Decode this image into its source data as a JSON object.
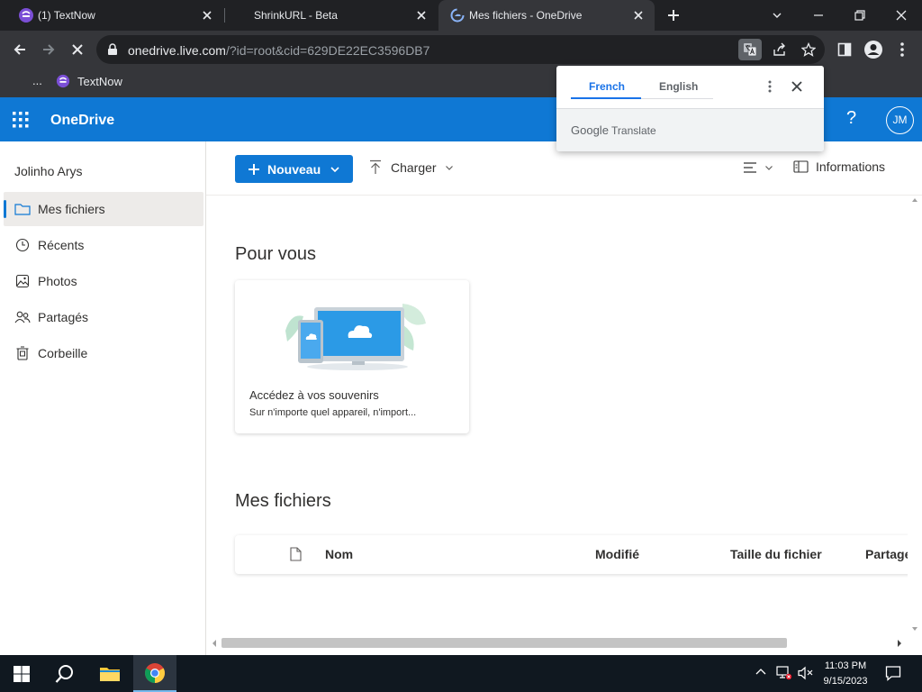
{
  "browser": {
    "tabs": [
      {
        "title": "(1) TextNow",
        "active": false
      },
      {
        "title": "ShrinkURL - Beta",
        "active": false
      },
      {
        "title": "Mes fichiers - OneDrive",
        "active": true
      }
    ],
    "url_host": "onedrive.live.com",
    "url_path": "/?id=root&cid=629DE22EC3596DB7",
    "bookmarks": {
      "ellipsis": "...",
      "item": "TextNow"
    }
  },
  "translate_popup": {
    "source_lang": "French",
    "target_lang": "English",
    "brand_google": "Google",
    "brand_translate": "Translate"
  },
  "onedrive": {
    "brand": "OneDrive",
    "help": "?",
    "avatar_initials": "JM",
    "user_name": "Jolinho Arys",
    "nav": [
      {
        "label": "Mes fichiers",
        "icon": "folder-icon",
        "selected": true
      },
      {
        "label": "Récents",
        "icon": "clock-icon",
        "selected": false
      },
      {
        "label": "Photos",
        "icon": "image-icon",
        "selected": false
      },
      {
        "label": "Partagés",
        "icon": "people-icon",
        "selected": false
      },
      {
        "label": "Corbeille",
        "icon": "trash-icon",
        "selected": false
      }
    ],
    "commands": {
      "new": "Nouveau",
      "upload": "Charger",
      "info": "Informations"
    },
    "for_you": {
      "title": "Pour vous",
      "card_title": "Accédez à vos souvenirs",
      "card_sub": "Sur n'importe quel appareil, n'import..."
    },
    "files": {
      "title": "Mes fichiers",
      "columns": [
        "Nom",
        "Modifié",
        "Taille du fichier",
        "Partage"
      ]
    }
  },
  "taskbar": {
    "time": "11:03 PM",
    "date": "9/15/2023"
  },
  "colors": {
    "onedrive_blue": "#0f78d4",
    "chrome_dark": "#202124",
    "chrome_toolbar": "#35363a",
    "translate_blue": "#1a73e8"
  }
}
